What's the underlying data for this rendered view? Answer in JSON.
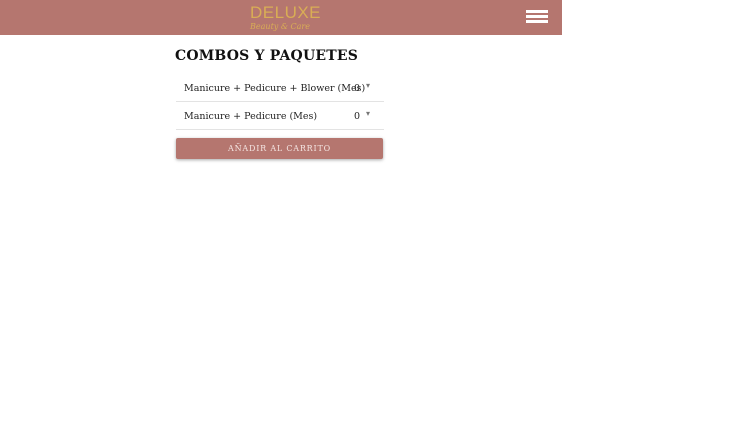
{
  "header": {
    "logo_main": "DELUXE",
    "logo_sub": "Beauty & Care",
    "menu_icon": "hamburger-menu-icon",
    "background_color": "#b5766f",
    "logo_color": "#d9ad55"
  },
  "section": {
    "title": "COMBOS Y PAQUETES"
  },
  "items": [
    {
      "label": "Manicure + Pedicure + Blower (Mes)",
      "quantity": "0"
    },
    {
      "label": "Manicure + Pedicure (Mes)",
      "quantity": "0"
    }
  ],
  "cart_button": {
    "label": "AÑADIR AL CARRITO",
    "color": "#b5766f"
  }
}
